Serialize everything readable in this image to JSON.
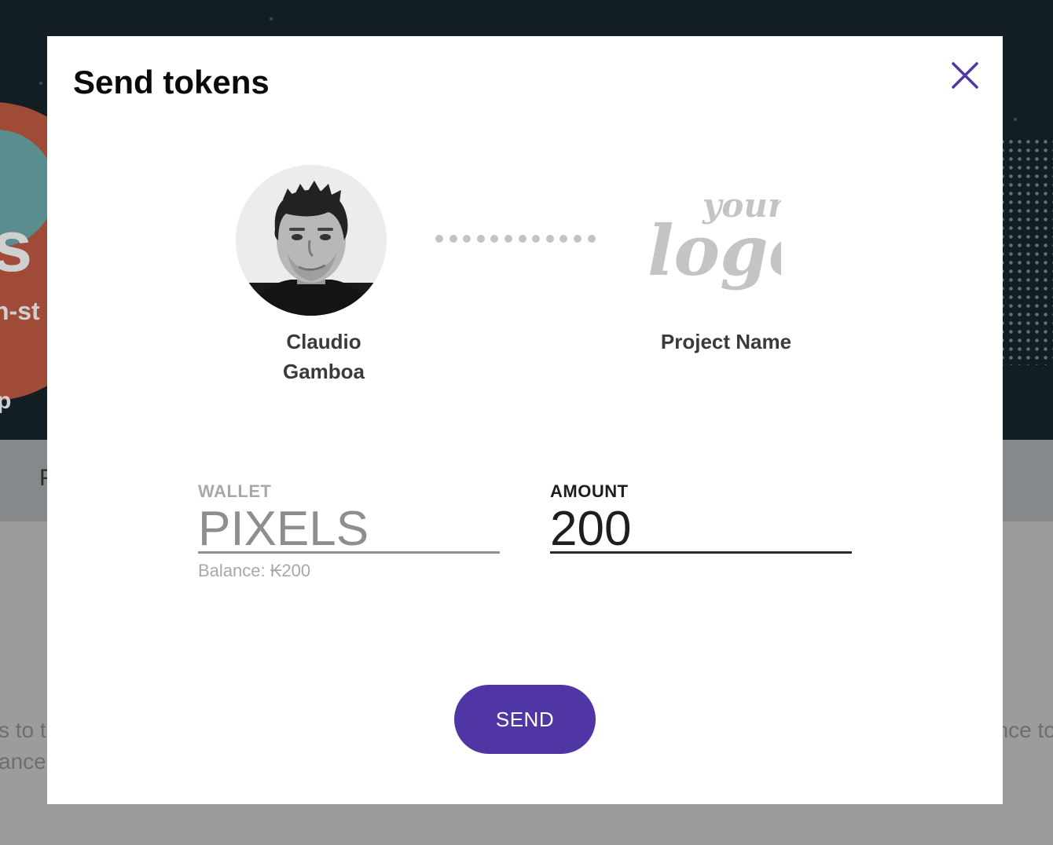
{
  "background": {
    "hero_title": "s C",
    "hero_subtitle": "n-st",
    "hero_extra": "p",
    "tab_fragment": "P",
    "text_left_line1": "s to t",
    "text_left_line2": "ance",
    "text_right_line1": "ance to"
  },
  "modal": {
    "title": "Send tokens",
    "close_icon": "close-icon",
    "sender": {
      "name_line1": "Claudio",
      "name_line2": "Gamboa",
      "avatar_icon": "user-avatar"
    },
    "connector_icon": "dotted-connector",
    "recipient": {
      "logo_text_small": "your",
      "logo_text_large": "logo",
      "name": "Project Name"
    },
    "wallet": {
      "label": "WALLET",
      "value": "PIXELS",
      "balance": "Balance: ₭200"
    },
    "amount": {
      "label": "AMOUNT",
      "value": "200"
    },
    "send_button": "SEND"
  },
  "colors": {
    "accent": "#4f36a4",
    "close_icon": "#4f36a4",
    "muted_text": "#a8a8a8",
    "label_dark": "#1e1e1e"
  }
}
